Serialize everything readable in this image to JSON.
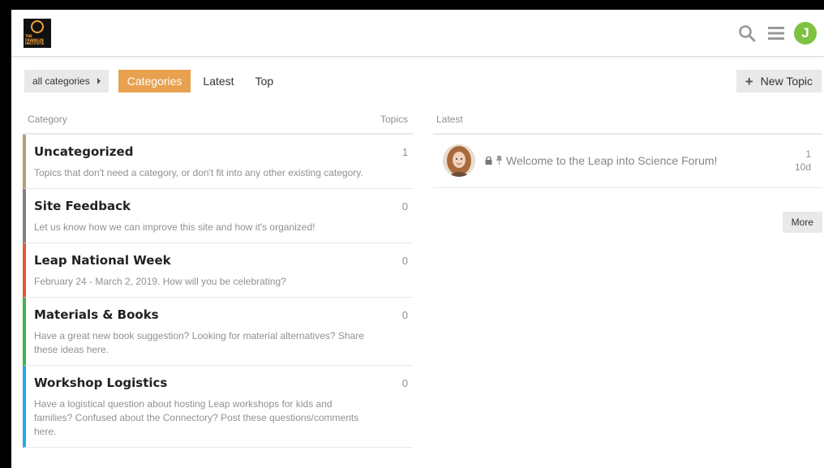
{
  "header": {
    "logo_text": "THE FRANKLIN INSTITUTE",
    "avatar_letter": "J",
    "icons": [
      "search-icon",
      "hamburger-menu-icon",
      "user-avatar"
    ]
  },
  "nav": {
    "category_dropdown": "all categories",
    "tabs": [
      "Categories",
      "Latest",
      "Top"
    ],
    "active_tab": "Categories",
    "new_topic_label": "New Topic"
  },
  "categories_table": {
    "col_category": "Category",
    "col_topics": "Topics",
    "rows": [
      {
        "name": "Uncategorized",
        "description": "Topics that don't need a category, or don't fit into any other existing category.",
        "topics": "1",
        "color": "#b3a078"
      },
      {
        "name": "Site Feedback",
        "description": "Let us know how we can improve this site and how it's organized!",
        "topics": "0",
        "color": "#808281"
      },
      {
        "name": "Leap National Week",
        "description": "February 24 - March 2, 2019. How will you be celebrating?",
        "topics": "0",
        "color": "#e45735"
      },
      {
        "name": "Materials & Books",
        "description": "Have a great new book suggestion? Looking for material alternatives? Share these ideas here.",
        "topics": "0",
        "color": "#3ab54a"
      },
      {
        "name": "Workshop Logistics",
        "description": "Have a logistical question about hosting Leap workshops for kids and families? Confused about the Connectory? Post these questions/comments here.",
        "topics": "0",
        "color": "#25aae2"
      }
    ]
  },
  "latest": {
    "header": "Latest",
    "topics": [
      {
        "title": "Welcome to the Leap into Science Forum!",
        "posts": "1",
        "age": "10d"
      }
    ],
    "more_label": "More"
  },
  "colors": {
    "accent": "#e8a14f",
    "avatar_green": "#7ec242"
  }
}
